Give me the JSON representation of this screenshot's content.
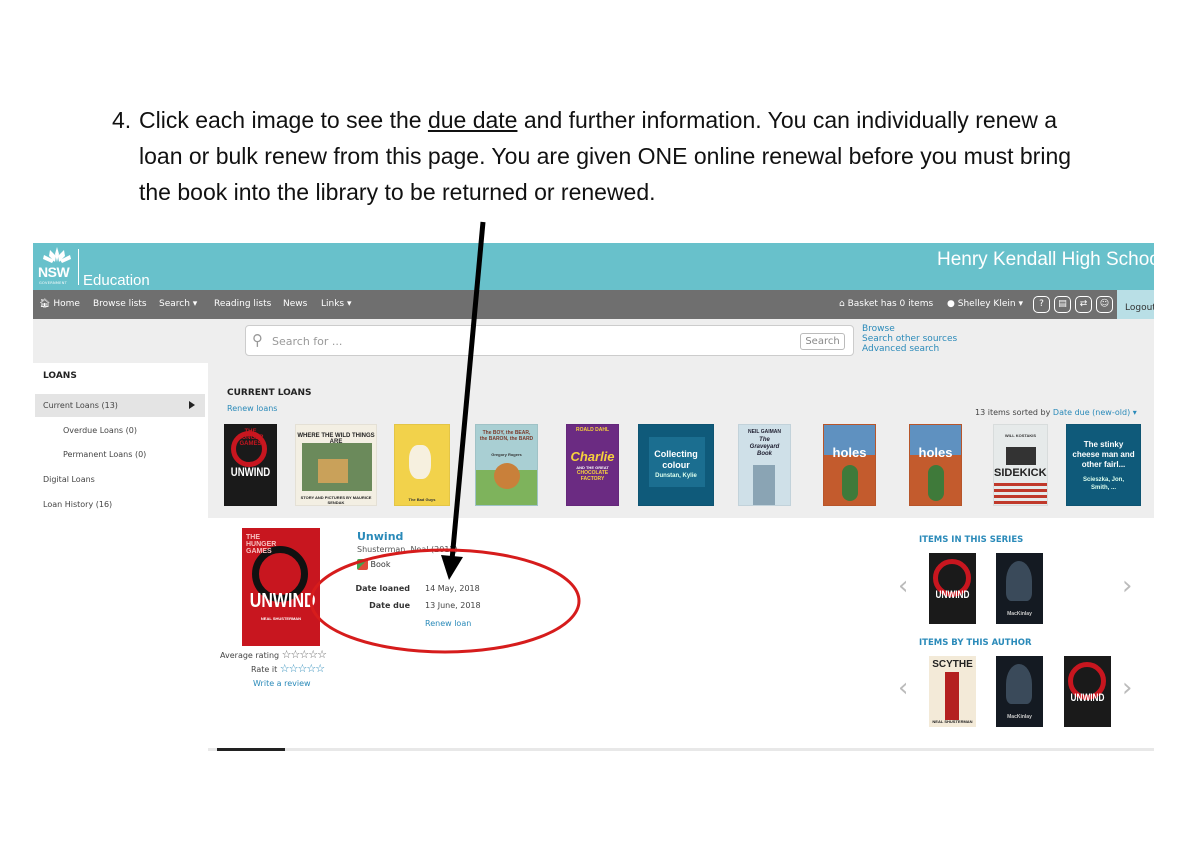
{
  "instruction": {
    "number": "4.",
    "lines": [
      "Click each image to see the",
      "due date",
      " and further information.  You can individually renew a",
      "loan or bulk renew from this page. You are given ONE online renewal before you must bring",
      "the book into the library to be returned or renewed."
    ]
  },
  "banner": {
    "logo_text": "NSW",
    "logo_sub": "GOVERNMENT",
    "brand": "Education",
    "school": "Henry Kendall High School",
    "color": "#68c1cb"
  },
  "nav": {
    "home": "Home",
    "browse": "Browse lists",
    "search": "Search",
    "reading": "Reading lists",
    "news": "News",
    "links": "Links",
    "basket": "Basket has 0 items",
    "user": "Shelley Klein",
    "logout": "Logout",
    "icons": [
      "help-icon",
      "notes-icon",
      "transfer-icon",
      "accessibility-icon"
    ]
  },
  "search": {
    "placeholder": "Search for ...",
    "button": "Search",
    "links": [
      "Browse",
      "Search other sources",
      "Advanced search"
    ]
  },
  "sidebar": {
    "heading": "LOANS",
    "items": [
      "Current Loans (13)",
      "Overdue Loans (0)",
      "Permanent Loans (0)",
      "Digital Loans",
      "Loan History (16)"
    ]
  },
  "loans": {
    "title": "CURRENT LOANS",
    "renew_all": "Renew loans",
    "sorted_prefix": "13 items sorted by",
    "sorted_value": "Date due (new-old) ▾",
    "books": [
      {
        "t1": "THE",
        "t2": "HUNGER",
        "t3": "GAMES",
        "big": "UNWIND"
      },
      {
        "t1": "WHERE THE WILD THINGS ARE",
        "t2": "STORY AND PICTURES BY MAURICE SENDAK"
      },
      {
        "t1": "The Bad Guys"
      },
      {
        "t1": "The BOY, the BEAR, the BARON, the BARD",
        "t2": "Gregory Rogers"
      },
      {
        "t1": "ROALD DAHL",
        "t2": "Charlie",
        "t3": "AND THE GREAT",
        "t4": "CHOCOLATE FACTORY"
      },
      {
        "t1": "Collecting",
        "t2": "colour",
        "t3": "Dunstan, Kylie"
      },
      {
        "t1": "NEIL GAIMAN",
        "t2": "The",
        "t3": "Graveyard",
        "t4": "Book"
      },
      {
        "t1": "holes"
      },
      {
        "t1": "holes"
      },
      {
        "t1": "WILL KOSTAKIS",
        "t2": "SIDEKICKS"
      },
      {
        "t1": "The stinky cheese man and other fairl...",
        "t2": "Scieszka, Jon, Smith, ..."
      }
    ]
  },
  "detail": {
    "cover_a": "THE",
    "cover_b": "HUNGER",
    "cover_c": "GAMES",
    "cover_big": "UNWIND",
    "cover_author": "NEAL SHUSTERMAN",
    "title": "Unwind",
    "author": "Shusterman, Neal (2012)",
    "type": "Book",
    "date_loaned_label": "Date loaned",
    "date_loaned": "14 May, 2018",
    "date_due_label": "Date due",
    "date_due": "13 June, 2018",
    "renew": "Renew loan",
    "avg_rating": "Average rating",
    "rate_it": "Rate it",
    "stars": "☆☆☆☆☆",
    "write_review": "Write a review",
    "series_heading": "ITEMS IN THIS SERIES",
    "author_heading": "ITEMS BY THIS AUTHOR",
    "series_books": [
      {
        "big": "UNWIND"
      },
      {
        "big": "MacKinlay"
      }
    ],
    "author_books": [
      {
        "big": "SCYTHE",
        "small": "NEAL SHUSTERMAN"
      },
      {
        "big": "MacKinlay"
      },
      {
        "big": "UNWIND"
      }
    ]
  },
  "colors": {
    "link": "#2a8ab9",
    "nav_bg": "#6f6f6f",
    "annotation": "#d61c1c",
    "arrow": "#000000"
  }
}
